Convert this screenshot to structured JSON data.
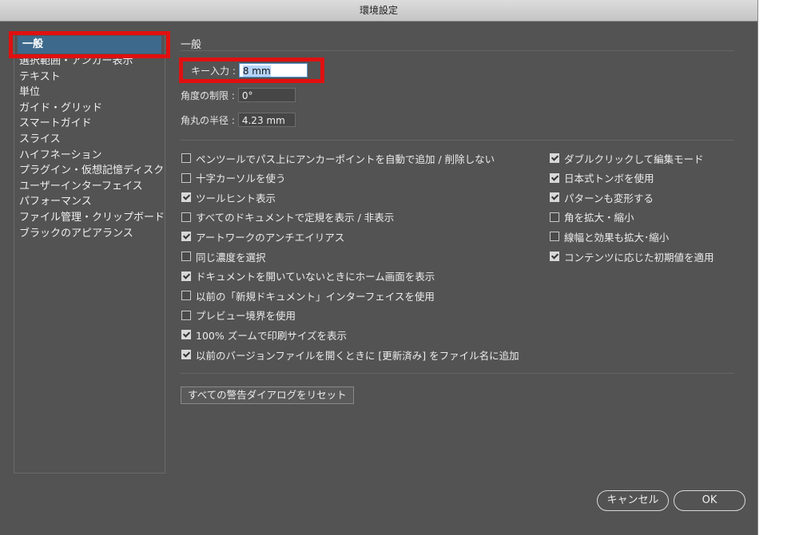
{
  "window": {
    "title": "環境設定"
  },
  "sidebar": {
    "items": [
      {
        "label": "一般",
        "selected": true
      },
      {
        "label": "選択範囲・アンカー表示"
      },
      {
        "label": "テキスト"
      },
      {
        "label": "単位"
      },
      {
        "label": "ガイド・グリッド"
      },
      {
        "label": "スマートガイド"
      },
      {
        "label": "スライス"
      },
      {
        "label": "ハイフネーション"
      },
      {
        "label": "プラグイン・仮想記憶ディスク"
      },
      {
        "label": "ユーザーインターフェイス"
      },
      {
        "label": "パフォーマンス"
      },
      {
        "label": "ファイル管理・クリップボード"
      },
      {
        "label": "ブラックのアピアランス"
      }
    ]
  },
  "main": {
    "section_title": "一般",
    "fields": {
      "key_input": {
        "label": "キー入力 :",
        "value": "8 mm"
      },
      "angle": {
        "label": "角度の制限 :",
        "value": "0°"
      },
      "corner_radius": {
        "label": "角丸の半径 :",
        "value": "4.23 mm"
      }
    },
    "left_options": [
      {
        "label": "ペンツールでパス上にアンカーポイントを自動で追加 / 削除しない",
        "checked": false
      },
      {
        "label": "十字カーソルを使う",
        "checked": false
      },
      {
        "label": "ツールヒント表示",
        "checked": true
      },
      {
        "label": "すべてのドキュメントで定規を表示 / 非表示",
        "checked": false
      },
      {
        "label": "アートワークのアンチエイリアス",
        "checked": true
      },
      {
        "label": "同じ濃度を選択",
        "checked": false
      },
      {
        "label": "ドキュメントを開いていないときにホーム画面を表示",
        "checked": true
      },
      {
        "label": "以前の「新規ドキュメント」インターフェイスを使用",
        "checked": false
      },
      {
        "label": "プレビュー境界を使用",
        "checked": false
      },
      {
        "label": "100% ズームで印刷サイズを表示",
        "checked": true
      },
      {
        "label": "以前のバージョンファイルを開くときに [更新済み] をファイル名に追加",
        "checked": true
      }
    ],
    "right_options": [
      {
        "label": "ダブルクリックして編集モード",
        "checked": true
      },
      {
        "label": "日本式トンボを使用",
        "checked": true
      },
      {
        "label": "パターンも変形する",
        "checked": true
      },
      {
        "label": "角を拡大・縮小",
        "checked": false
      },
      {
        "label": "線幅と効果も拡大･縮小",
        "checked": false
      },
      {
        "label": "コンテンツに応じた初期値を適用",
        "checked": true
      }
    ],
    "reset_button": "すべての警告ダイアログをリセット"
  },
  "footer": {
    "cancel": "キャンセル",
    "ok": "OK"
  }
}
